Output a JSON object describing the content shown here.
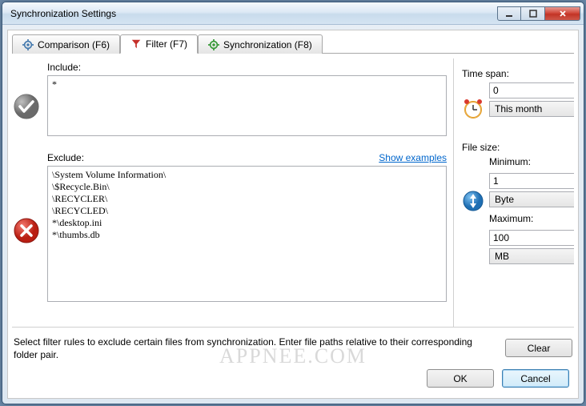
{
  "window": {
    "title": "Synchronization Settings"
  },
  "tabs": [
    {
      "label": "Comparison (F6)"
    },
    {
      "label": "Filter (F7)"
    },
    {
      "label": "Synchronization (F8)"
    }
  ],
  "include": {
    "label": "Include:",
    "value": "*"
  },
  "exclude": {
    "label": "Exclude:",
    "show_examples": "Show examples",
    "value": "\\System Volume Information\\\n\\$Recycle.Bin\\\n\\RECYCLER\\\n\\RECYCLED\\\n*\\desktop.ini\n*\\thumbs.db"
  },
  "timespan": {
    "label": "Time span:",
    "value": "0",
    "unit": "This month"
  },
  "filesize": {
    "label": "File size:",
    "min_label": "Minimum:",
    "min_value": "1",
    "min_unit": "Byte",
    "max_label": "Maximum:",
    "max_value": "100",
    "max_unit": "MB"
  },
  "hint": "Select filter rules to exclude certain files from synchronization. Enter file paths relative to their corresponding folder pair.",
  "buttons": {
    "clear": "Clear",
    "ok": "OK",
    "cancel": "Cancel"
  },
  "watermark": "APPNEE.COM"
}
